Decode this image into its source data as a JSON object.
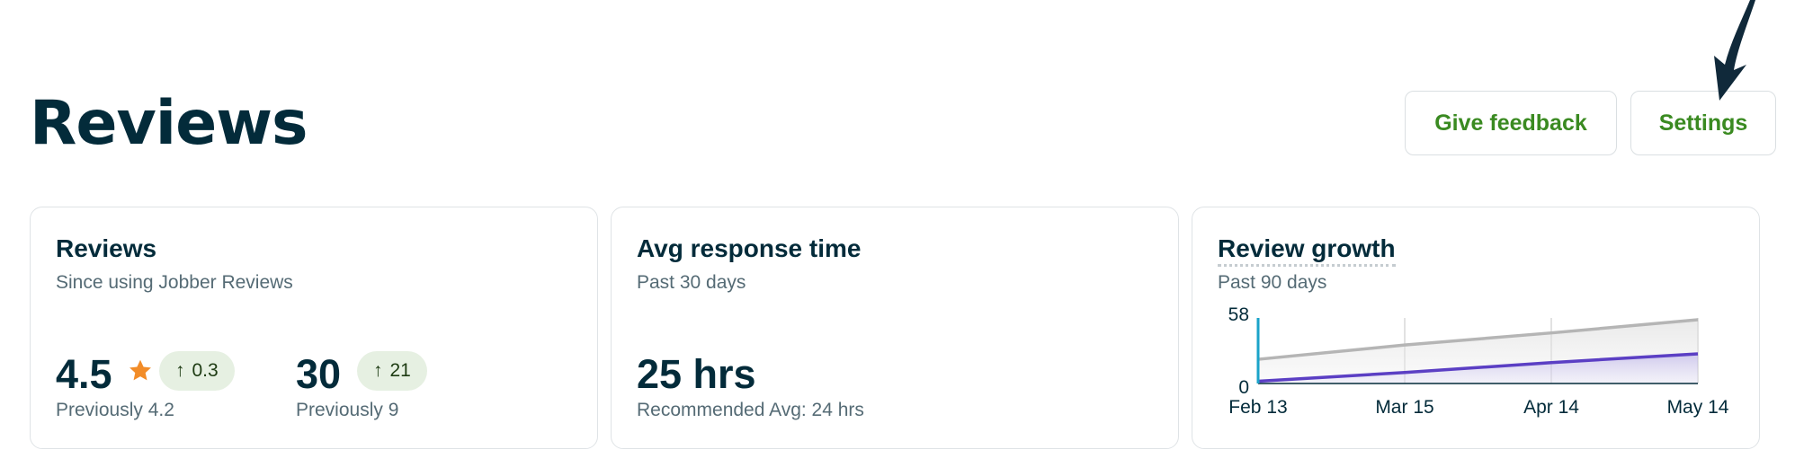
{
  "header": {
    "title": "Reviews",
    "give_feedback_label": "Give feedback",
    "settings_label": "Settings"
  },
  "cards": {
    "reviews": {
      "title": "Reviews",
      "subtitle": "Since using Jobber Reviews",
      "rating": "4.5",
      "rating_change": "0.3",
      "rating_previous": "Previously 4.2",
      "count": "30",
      "count_change": "21",
      "count_previous": "Previously 9"
    },
    "response_time": {
      "title": "Avg response time",
      "subtitle": "Past 30 days",
      "value": "25 hrs",
      "recommended": "Recommended Avg: 24 hrs"
    },
    "growth": {
      "title": "Review growth",
      "subtitle": "Past 90 days"
    }
  },
  "colors": {
    "brand_green": "#3a8a21",
    "star": "#f28c28",
    "series_gray": "#b5b5b5",
    "series_purple": "#5b3fc4",
    "axis_accent": "#1aa3c9"
  },
  "icons": [
    "arrow-up-icon",
    "star-icon",
    "pointer-arrow-icon"
  ],
  "chart_data": {
    "type": "area",
    "title": "Review growth",
    "subtitle": "Past 90 days",
    "categories": [
      "Feb 13",
      "Mar 15",
      "Apr 14",
      "May 14"
    ],
    "yticks": [
      "0",
      "58"
    ],
    "ylim": [
      0,
      58
    ],
    "series": [
      {
        "values": [
          22,
          35,
          46,
          58
        ]
      },
      {
        "values": [
          2,
          10,
          19,
          27
        ]
      }
    ],
    "grid": true
  }
}
